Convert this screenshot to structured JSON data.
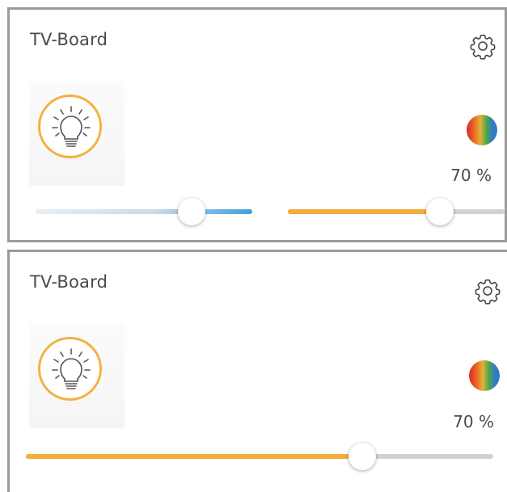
{
  "cards": [
    {
      "title": "TV-Board",
      "brightness_label": "70 %",
      "brightness_value": 0.7,
      "color_temperature_value": 0.72,
      "icons": [
        "gear-icon",
        "lightbulb-icon",
        "color-picker-icon"
      ]
    },
    {
      "title": "TV-Board",
      "brightness_label": "70 %",
      "brightness_value": 0.72,
      "icons": [
        "gear-icon",
        "lightbulb-icon",
        "color-picker-icon"
      ]
    }
  ],
  "colors": {
    "accent": "#f4ad3b",
    "temperature_cool": "#3da3dc",
    "border": "#9b9b9b",
    "text": "#4a4a4a"
  }
}
